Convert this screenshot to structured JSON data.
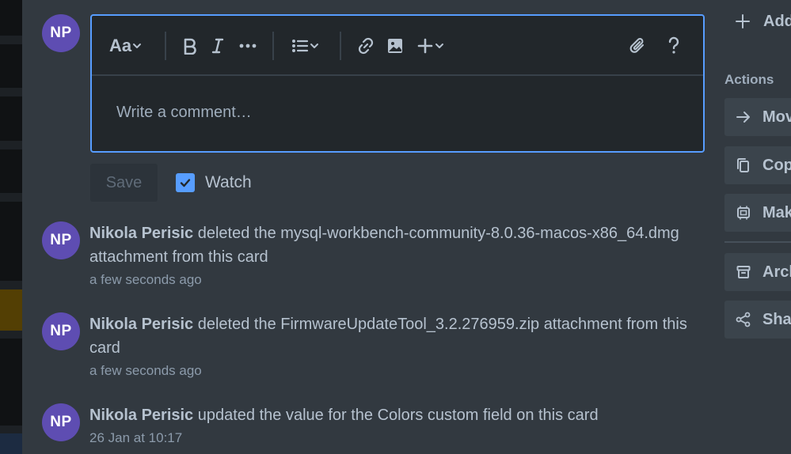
{
  "user": {
    "initials": "NP"
  },
  "editor": {
    "text_style_label": "Aa",
    "placeholder": "Write a comment…"
  },
  "comment_controls": {
    "save_label": "Save",
    "watch_label": "Watch",
    "watch_checked": true
  },
  "activities": [
    {
      "author": "Nikola Perisic",
      "text": " deleted the mysql-workbench-community-8.0.36-macos-x86_64.dmg attachment from this card",
      "time": "a few seconds ago"
    },
    {
      "author": "Nikola Perisic",
      "text": " deleted the FirmwareUpdateTool_3.2.276959.zip attachment from this card",
      "time": "a few seconds ago"
    },
    {
      "author": "Nikola Perisic",
      "text": " updated the value for the Colors custom field on this card",
      "time": "26 Jan at 10:17"
    }
  ],
  "sidebar": {
    "add_label": "Add",
    "actions_heading": "Actions",
    "actions": [
      {
        "label": "Move",
        "icon": "arrow-right-icon"
      },
      {
        "label": "Copy",
        "icon": "copy-icon"
      },
      {
        "label": "Make template",
        "icon": "template-icon"
      },
      {
        "label": "Archive",
        "icon": "archive-icon"
      },
      {
        "label": "Share",
        "icon": "share-icon"
      }
    ]
  },
  "colors": {
    "background": "#323940",
    "accent": "#579dff",
    "avatar": "#5e4db2"
  }
}
